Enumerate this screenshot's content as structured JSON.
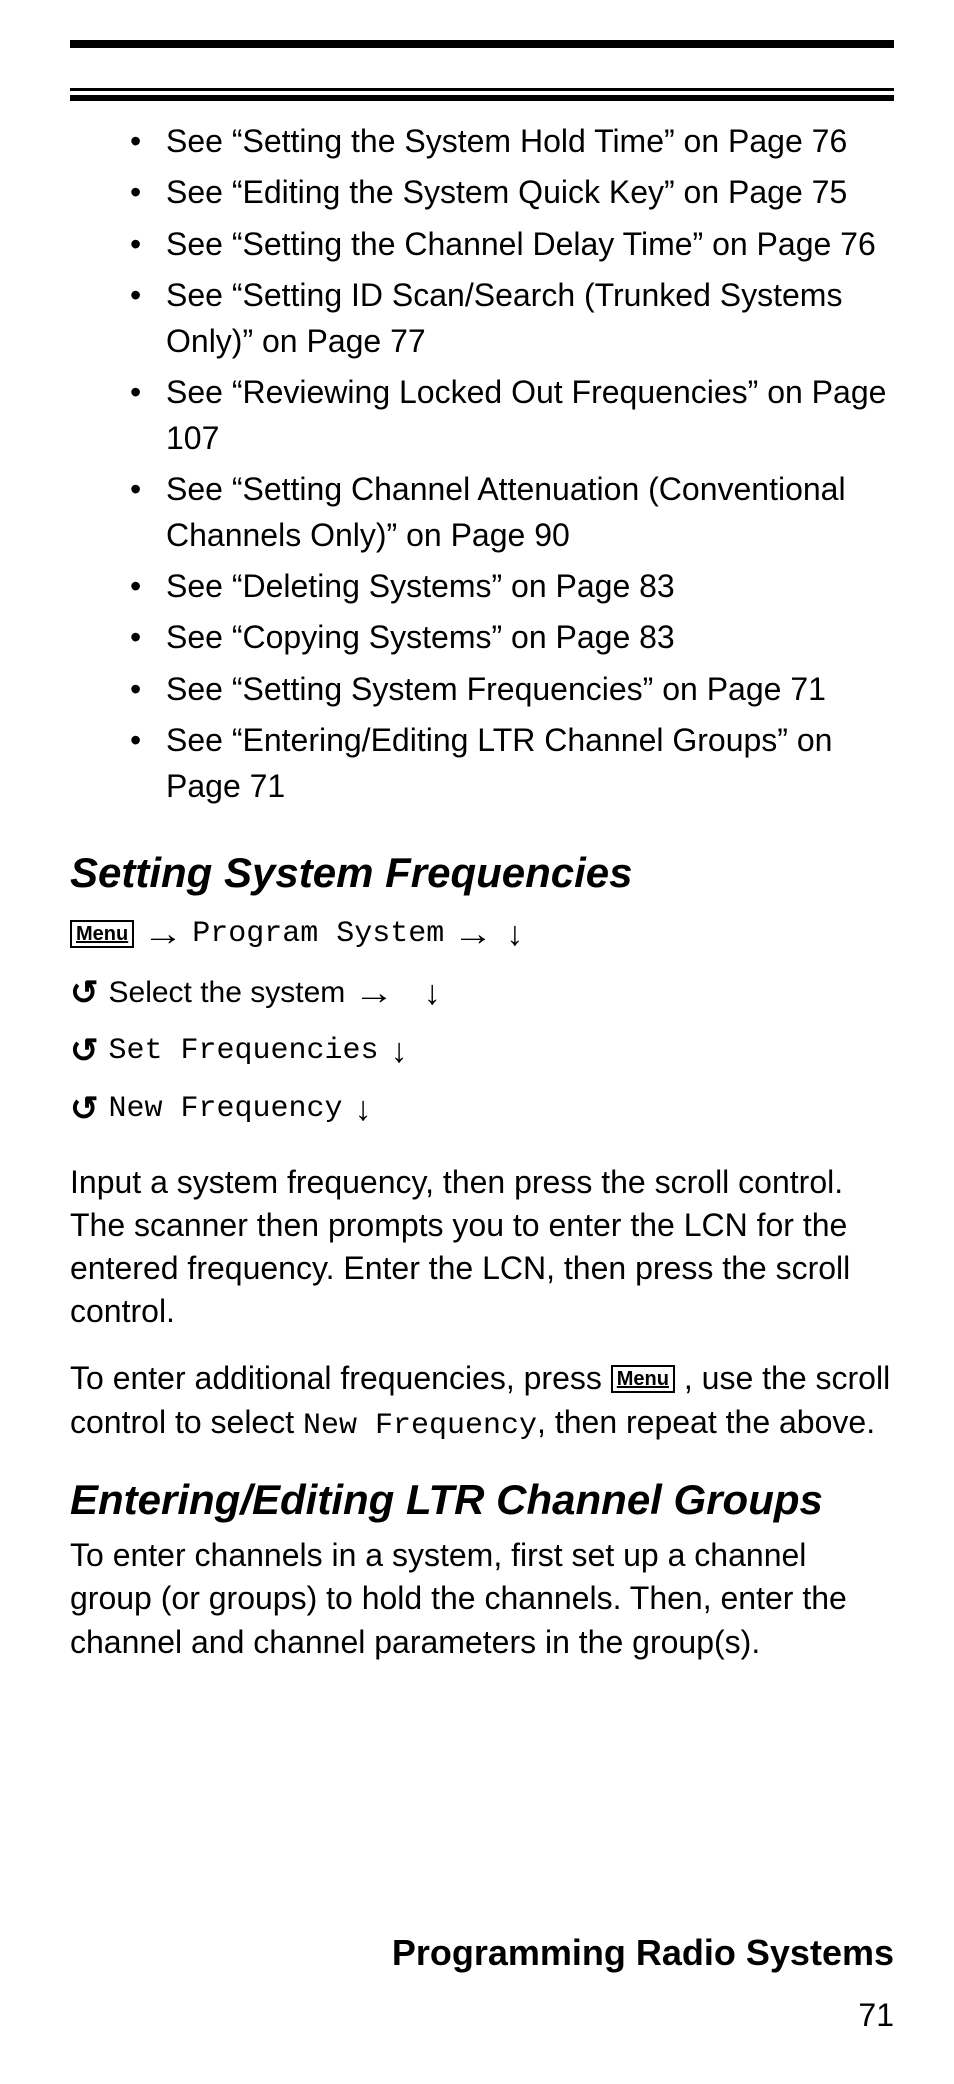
{
  "refs": [
    "See “Setting the System Hold Time” on Page 76",
    "See “Editing the System Quick Key” on Page 75",
    "See “Setting the Channel Delay Time” on Page 76",
    "See “Setting ID Scan/Search (Trunked Systems Only)” on Page 77",
    "See “Reviewing Locked Out Frequencies” on Page 107",
    "See “Setting Channel Attenuation (Conventional Channels Only)” on Page 90",
    "See “Deleting Systems” on Page 83",
    "See “Copying Systems” on Page 83",
    "See “Setting System Frequencies” on Page 71",
    "See “Entering/Editing LTR Channel Groups” on Page 71"
  ],
  "section1": {
    "title": "Setting System Frequencies",
    "menu_label": "Menu",
    "nav1_text": "Program System",
    "nav2_text": "Select the system",
    "nav3_text": "Set Frequencies",
    "nav4_text": "New Frequency",
    "para1": "Input a system frequency, then press the scroll control. The scanner then prompts you to enter the LCN for the entered frequency. Enter the LCN, then press the scroll control.",
    "para2_a": "To enter additional frequencies, press ",
    "para2_b": " , use the scroll control to select ",
    "para2_code": "New Frequency",
    "para2_c": ", then repeat the above."
  },
  "section2": {
    "title": "Entering/Editing LTR Channel Groups",
    "para1": "To enter channels in a system, first set up a channel group (or groups) to hold the channels. Then, enter the channel and channel parameters in the group(s)."
  },
  "footer": {
    "title": "Programming Radio Systems",
    "page": "71"
  },
  "glyphs": {
    "arrow_right": "→",
    "arrow_down": "↓",
    "scroll": "↻"
  }
}
